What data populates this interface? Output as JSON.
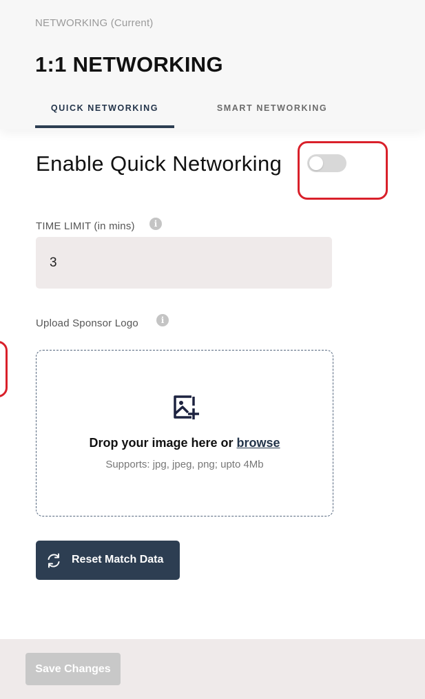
{
  "header": {
    "breadcrumb": "NETWORKING (Current)",
    "title": "1:1 NETWORKING",
    "tabs": [
      {
        "label": "QUICK NETWORKING",
        "active": true
      },
      {
        "label": "SMART NETWORKING",
        "active": false
      }
    ]
  },
  "quick_networking": {
    "enable_label": "Enable Quick Networking",
    "enabled": false,
    "time_limit": {
      "label": "TIME LIMIT (in mins)",
      "value": "3"
    },
    "upload": {
      "label": "Upload Sponsor Logo",
      "drop_text": "Drop your image here or ",
      "browse_text": "browse",
      "hint": "Supports: jpg, jpeg, png; upto 4Mb"
    },
    "reset_button": "Reset Match Data"
  },
  "footer": {
    "save_button": "Save Changes",
    "save_enabled": false
  },
  "icons": {
    "info": "info-icon",
    "image_add": "image-add-icon",
    "reset": "refresh-icon"
  },
  "colors": {
    "accent": "#2d3e52",
    "highlight": "#d9202a",
    "input_bg": "#efeaea",
    "disabled_button": "#c8c8c8"
  }
}
